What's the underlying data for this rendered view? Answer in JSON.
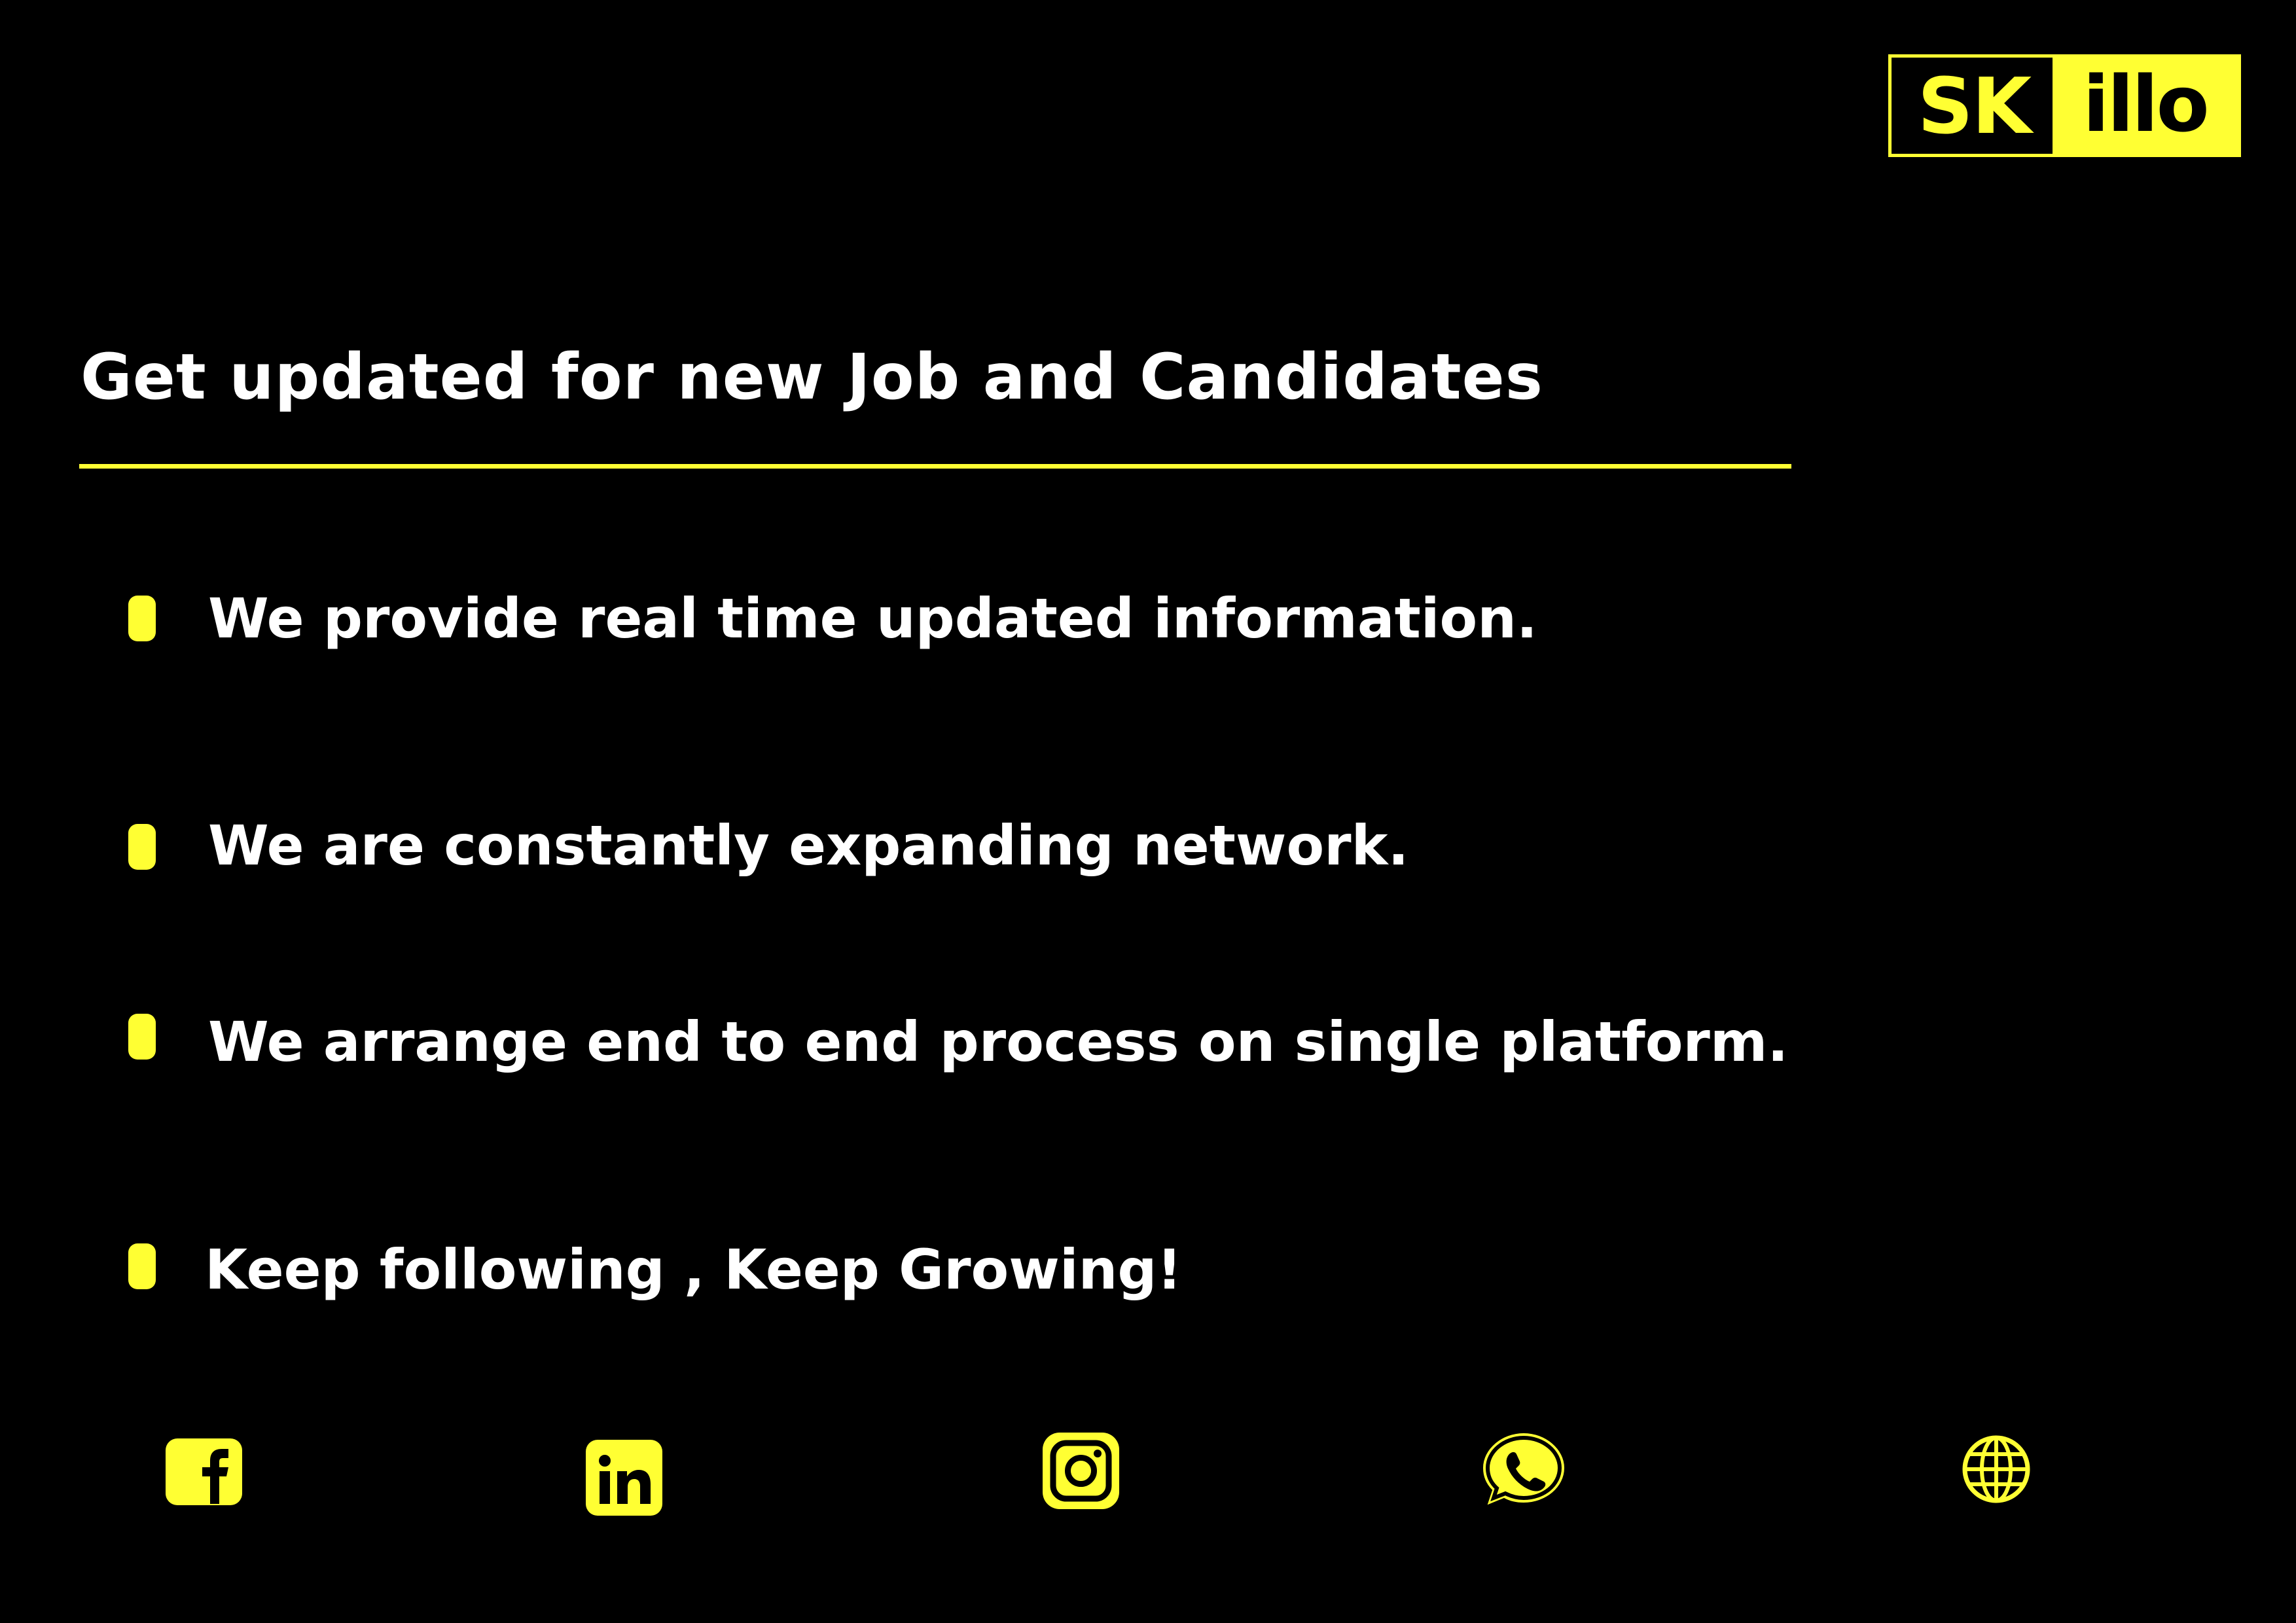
{
  "logo": {
    "left_text": "SK",
    "right_text": "illo"
  },
  "headline": "Get updated for new Job and Candidates",
  "points": [
    "We provide real time updated information.",
    "We are constantly expanding network.",
    "We arrange end to end process on single platform.",
    "Keep following , Keep Growing!"
  ],
  "social_icons": [
    "facebook-icon",
    "linkedin-icon",
    "instagram-icon",
    "whatsapp-icon",
    "globe-icon"
  ],
  "colors": {
    "background": "#000000",
    "accent": "#ffff33",
    "text": "#ffffff"
  }
}
